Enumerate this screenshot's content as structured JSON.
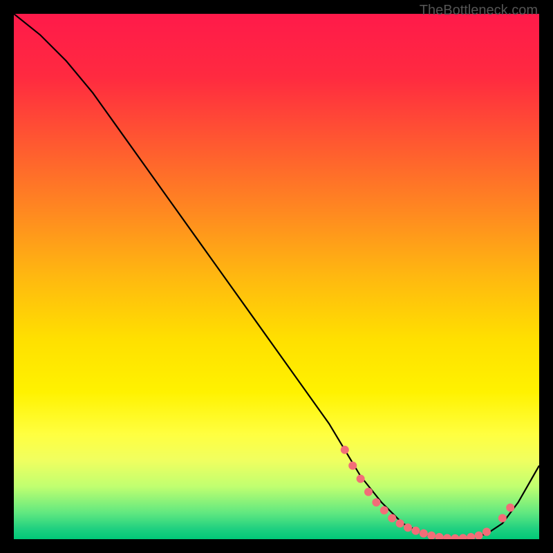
{
  "watermark": "TheBottleneck.com",
  "chart_data": {
    "type": "line",
    "title": "",
    "xlabel": "",
    "ylabel": "",
    "xlim": [
      0,
      100
    ],
    "ylim": [
      0,
      100
    ],
    "series": [
      {
        "name": "curve",
        "x": [
          0,
          5,
          10,
          15,
          20,
          25,
          30,
          35,
          40,
          45,
          50,
          55,
          60,
          63,
          66,
          70,
          74,
          78,
          82,
          86,
          90,
          93,
          96,
          100
        ],
        "y": [
          100,
          96,
          91,
          85,
          78,
          71,
          64,
          57,
          50,
          43,
          36,
          29,
          22,
          17,
          12,
          7,
          3,
          1,
          0,
          0,
          1,
          3,
          7,
          14
        ]
      }
    ],
    "markers": [
      {
        "x": 63,
        "y": 17
      },
      {
        "x": 64.5,
        "y": 14
      },
      {
        "x": 66,
        "y": 11.5
      },
      {
        "x": 67.5,
        "y": 9
      },
      {
        "x": 69,
        "y": 7
      },
      {
        "x": 70.5,
        "y": 5.5
      },
      {
        "x": 72,
        "y": 4
      },
      {
        "x": 73.5,
        "y": 3
      },
      {
        "x": 75,
        "y": 2.2
      },
      {
        "x": 76.5,
        "y": 1.6
      },
      {
        "x": 78,
        "y": 1.1
      },
      {
        "x": 79.5,
        "y": 0.7
      },
      {
        "x": 81,
        "y": 0.4
      },
      {
        "x": 82.5,
        "y": 0.2
      },
      {
        "x": 84,
        "y": 0.15
      },
      {
        "x": 85.5,
        "y": 0.2
      },
      {
        "x": 87,
        "y": 0.4
      },
      {
        "x": 88.5,
        "y": 0.7
      },
      {
        "x": 90,
        "y": 1.4
      },
      {
        "x": 93,
        "y": 4
      },
      {
        "x": 94.5,
        "y": 6
      }
    ],
    "marker_color": "#f26d78",
    "curve_color": "#000000"
  }
}
